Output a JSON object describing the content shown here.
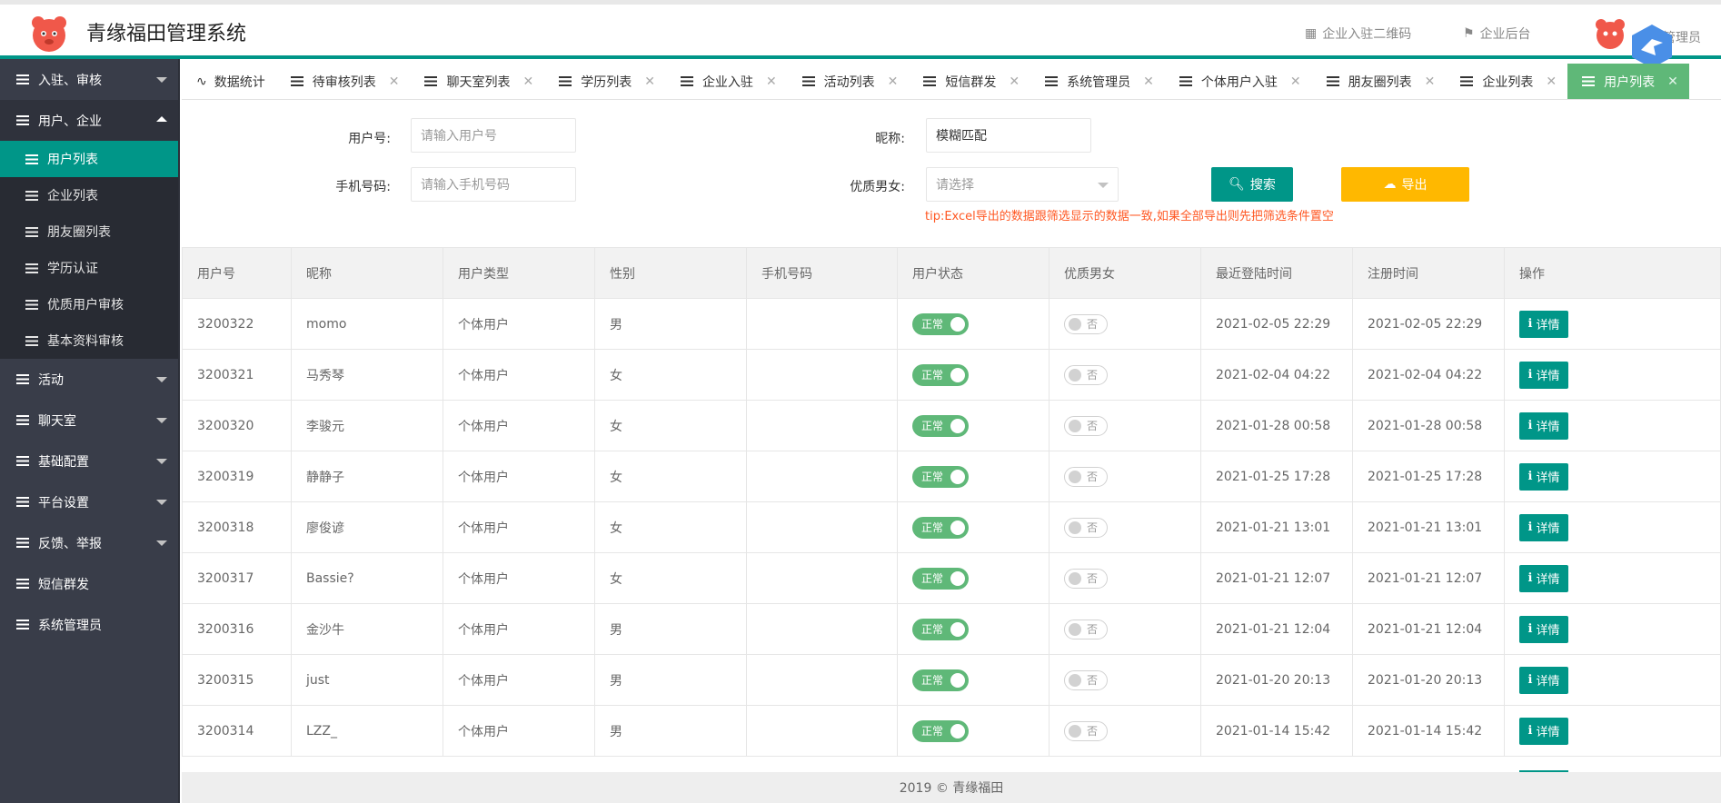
{
  "header": {
    "app_title": "青缘福田管理系统",
    "qr_link": "企业入驻二维码",
    "backend_link": "企业后台",
    "user_label": "管理员"
  },
  "sidebar": {
    "groups": [
      {
        "label": "入驻、审核",
        "open": false
      },
      {
        "label": "用户、企业",
        "open": true,
        "items": [
          "用户列表",
          "企业列表",
          "朋友圈列表",
          "学历认证",
          "优质用户审核",
          "基本资料审核"
        ]
      },
      {
        "label": "活动",
        "open": false
      },
      {
        "label": "聊天室",
        "open": false
      },
      {
        "label": "基础配置",
        "open": false
      },
      {
        "label": "平台设置",
        "open": false
      },
      {
        "label": "反馈、举报",
        "open": false
      },
      {
        "label": "短信群发",
        "open": false
      },
      {
        "label": "系统管理员",
        "open": false
      }
    ]
  },
  "tabs": [
    "数据统计",
    "待审核列表",
    "聊天室列表",
    "学历列表",
    "企业入驻",
    "活动列表",
    "短信群发",
    "系统管理员",
    "个体用户入驻",
    "朋友圈列表",
    "企业列表",
    "用户列表"
  ],
  "form": {
    "uid_label": "用户号:",
    "uid_placeholder": "请输入用户号",
    "nick_label": "昵称:",
    "nick_value": "模糊匹配",
    "phone_label": "手机号码:",
    "phone_placeholder": "请输入手机号码",
    "quality_label": "优质男女:",
    "quality_placeholder": "请选择",
    "search_label": "搜索",
    "export_label": "导出",
    "tip": "tip:Excel导出的数据跟筛选显示的数据一致,如果全部导出则先把筛选条件置空"
  },
  "table": {
    "columns": [
      "用户号",
      "昵称",
      "用户类型",
      "性别",
      "手机号码",
      "用户状态",
      "优质男女",
      "最近登陆时间",
      "注册时间",
      "操作"
    ],
    "status_on": "正常",
    "quality_off": "否",
    "detail_label": "详情",
    "rows": [
      {
        "id": "3200322",
        "nick": "momo",
        "type": "个体用户",
        "sex": "男",
        "phone": "",
        "last": "2021-02-05 22:29",
        "reg": "2021-02-05 22:29"
      },
      {
        "id": "3200321",
        "nick": "马秀琴",
        "type": "个体用户",
        "sex": "女",
        "phone": "",
        "last": "2021-02-04 04:22",
        "reg": "2021-02-04 04:22"
      },
      {
        "id": "3200320",
        "nick": "李骏元",
        "type": "个体用户",
        "sex": "女",
        "phone": "",
        "last": "2021-01-28 00:58",
        "reg": "2021-01-28 00:58"
      },
      {
        "id": "3200319",
        "nick": "静静子",
        "type": "个体用户",
        "sex": "女",
        "phone": "",
        "last": "2021-01-25 17:28",
        "reg": "2021-01-25 17:28"
      },
      {
        "id": "3200318",
        "nick": "廖俊谚",
        "type": "个体用户",
        "sex": "女",
        "phone": "",
        "last": "2021-01-21 13:01",
        "reg": "2021-01-21 13:01"
      },
      {
        "id": "3200317",
        "nick": "Bassie?",
        "type": "个体用户",
        "sex": "女",
        "phone": "",
        "last": "2021-01-21 12:07",
        "reg": "2021-01-21 12:07"
      },
      {
        "id": "3200316",
        "nick": "金沙牛",
        "type": "个体用户",
        "sex": "男",
        "phone": "",
        "last": "2021-01-21 12:04",
        "reg": "2021-01-21 12:04"
      },
      {
        "id": "3200315",
        "nick": "just",
        "type": "个体用户",
        "sex": "男",
        "phone": "",
        "last": "2021-01-20 20:13",
        "reg": "2021-01-20 20:13"
      },
      {
        "id": "3200314",
        "nick": "LZZ_",
        "type": "个体用户",
        "sex": "男",
        "phone": "",
        "last": "2021-01-14 15:42",
        "reg": "2021-01-14 15:42"
      }
    ]
  },
  "footer": "2019 © 青缘福田",
  "colors": {
    "primary": "#009688",
    "sidebar": "#393d49",
    "active_tab": "#5fb878",
    "export": "#ffb800",
    "tip": "#ff5722"
  }
}
